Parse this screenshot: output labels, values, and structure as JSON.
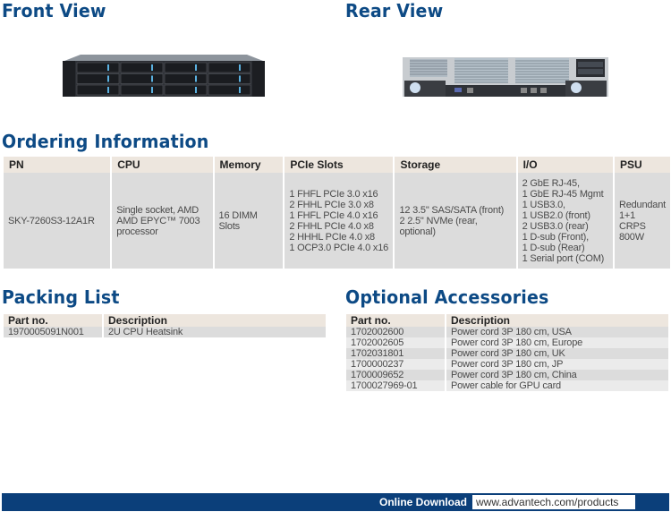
{
  "sections": {
    "front_view": "Front View",
    "rear_view": "Rear View",
    "ordering": "Ordering Information",
    "packing": "Packing List",
    "accessories": "Optional Accessories"
  },
  "images": {
    "front": "2U server front view with 12 drive bays",
    "rear": "2U server rear view with PCIe slots and redundant PSUs"
  },
  "ordering_table": {
    "headers": [
      "PN",
      "CPU",
      "Memory",
      "PCIe Slots",
      "Storage",
      "I/O",
      "PSU"
    ],
    "rows": [
      {
        "pn": "SKY-7260S3-12A1R",
        "cpu": [
          "Single socket, AMD",
          "AMD EPYC™ 7003",
          "processor"
        ],
        "memory": "16 DIMM Slots",
        "pcie": [
          "1 FHFL PCIe 3.0 x16",
          "2 FHHL PCIe 3.0 x8",
          "1 FHFL PCIe 4.0 x16",
          "2 FHHL PCIe 4.0 x8",
          "2 HHHL PCIe 4.0 x8",
          "1 OCP3.0 PCIe 4.0 x16"
        ],
        "storage": [
          "12 3.5\" SAS/SATA (front)",
          "2 2.5\" NVMe (rear, optional)"
        ],
        "io": [
          "2 GbE RJ-45,",
          "1 GbE RJ-45 Mgmt",
          "1 USB3.0,",
          "1 USB2.0 (front)",
          "2 USB3.0 (rear)",
          "1 D-sub (Front),",
          "1 D-sub (Rear)",
          "1 Serial port (COM)"
        ],
        "psu": [
          "Redundant 1+1",
          "CRPS 800W"
        ]
      }
    ]
  },
  "packing_table": {
    "headers": [
      "Part no.",
      "Description"
    ],
    "rows": [
      [
        "1970005091N001",
        "2U CPU Heatsink"
      ]
    ]
  },
  "accessories_table": {
    "headers": [
      "Part no.",
      "Description"
    ],
    "rows": [
      [
        "1702002600",
        "Power cord 3P 180 cm, USA"
      ],
      [
        "1702002605",
        "Power cord 3P 180 cm, Europe"
      ],
      [
        "1702031801",
        "Power cord 3P 180 cm, UK"
      ],
      [
        "1700000237",
        "Power cord 3P 180 cm, JP"
      ],
      [
        "1700009652",
        "Power cord 3P 180 cm, China"
      ],
      [
        "1700027969-01",
        "Power cable for GPU card"
      ]
    ]
  },
  "footer": {
    "label": "Online Download",
    "url": "www.advantech.com/products"
  },
  "colors": {
    "title_blue": "#0d4a85",
    "header_beige": "#ede6de",
    "row_gray": "#dcdcdc",
    "footer_blue": "#0b3f7a"
  }
}
